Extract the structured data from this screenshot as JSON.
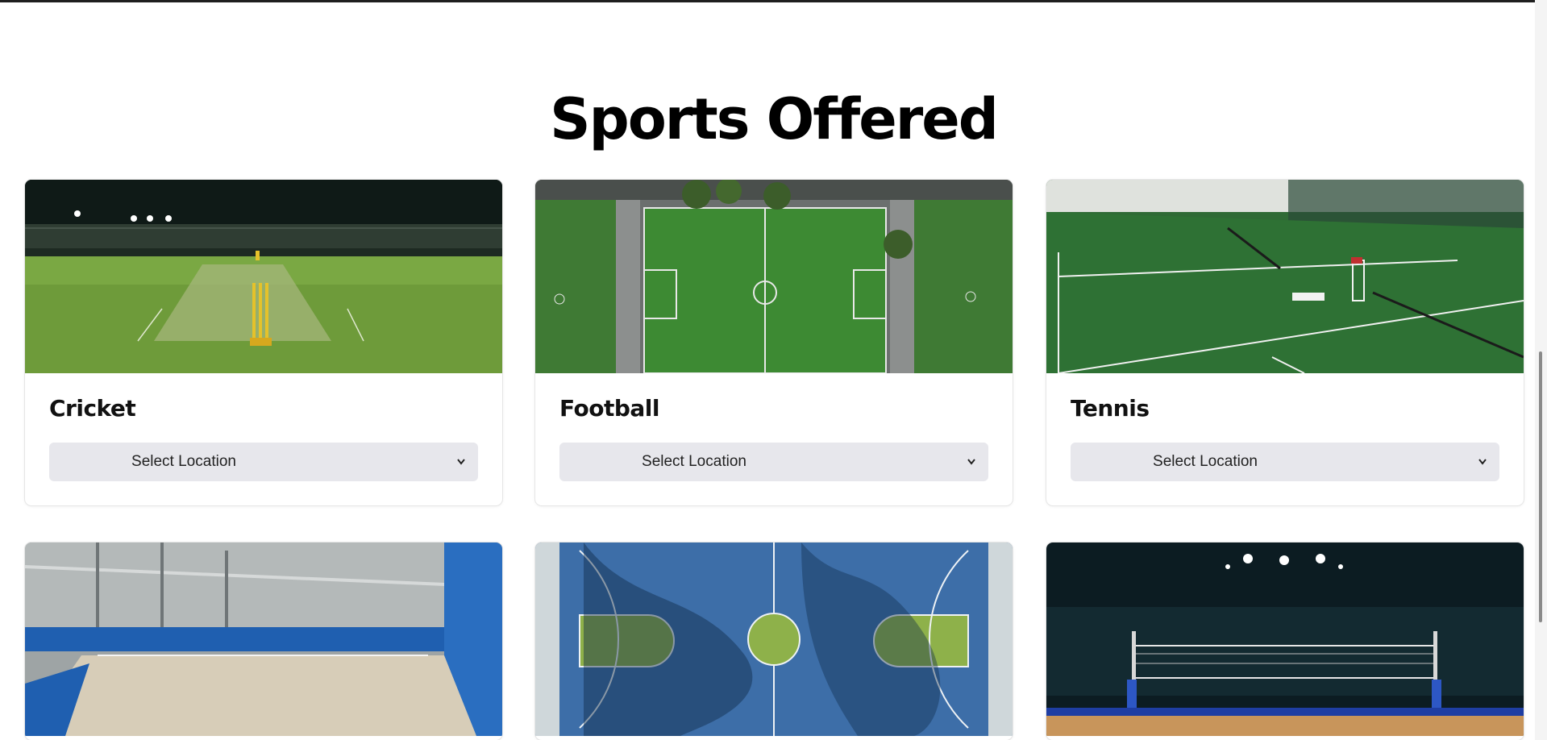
{
  "page": {
    "heading": "Sports Offered"
  },
  "sports": [
    {
      "name": "Cricket",
      "select_value": "Select Location",
      "image_icon": "cricket-ground-image"
    },
    {
      "name": "Football",
      "select_value": "Select Location",
      "image_icon": "football-field-image"
    },
    {
      "name": "Tennis",
      "select_value": "Select Location",
      "image_icon": "tennis-court-image"
    },
    {
      "name": "",
      "image_icon": "badminton-court-image"
    },
    {
      "name": "",
      "image_icon": "basketball-court-image"
    },
    {
      "name": "",
      "image_icon": "volleyball-court-image"
    }
  ],
  "colors": {
    "select_bg": "#e7e7ec",
    "card_border": "#e6e6e6",
    "heading": "#000000"
  }
}
